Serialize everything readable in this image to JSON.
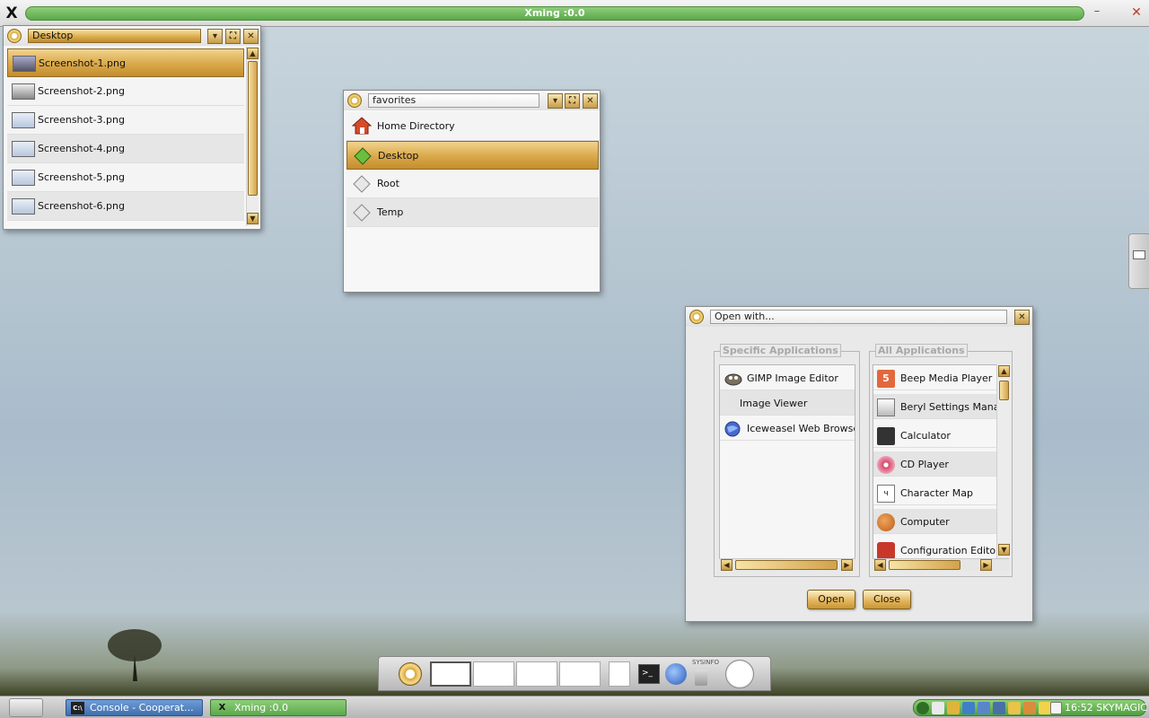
{
  "xming": {
    "title": "Xming :0.0",
    "logo": "X",
    "min": "–",
    "close": "✕"
  },
  "desktop_window": {
    "location": "Desktop",
    "files": [
      {
        "name": "Screenshot-1.png"
      },
      {
        "name": "Screenshot-2.png"
      },
      {
        "name": "Screenshot-3.png"
      },
      {
        "name": "Screenshot-4.png"
      },
      {
        "name": "Screenshot-5.png"
      },
      {
        "name": "Screenshot-6.png"
      }
    ]
  },
  "favorites_window": {
    "location": "favorites",
    "items": [
      {
        "name": "Home Directory",
        "icon": "home-icon"
      },
      {
        "name": "Desktop",
        "icon": "desktop-icon"
      },
      {
        "name": "Root",
        "icon": "root-icon"
      },
      {
        "name": "Temp",
        "icon": "temp-icon"
      }
    ]
  },
  "open_with": {
    "title": "Open with...",
    "specific_label": "Specific Applications",
    "all_label": "All Applications",
    "specific": [
      {
        "name": "GIMP Image Editor",
        "icon": "gimp-icon"
      },
      {
        "name": "Image Viewer",
        "icon": ""
      },
      {
        "name": "Iceweasel Web Browser",
        "icon": "globe-icon"
      }
    ],
    "all": [
      {
        "name": "Beep Media Player",
        "icon": "media-player-icon"
      },
      {
        "name": "Beryl Settings Manager",
        "icon": "settings-icon"
      },
      {
        "name": "Calculator",
        "icon": "calculator-icon"
      },
      {
        "name": "CD Player",
        "icon": "cd-icon"
      },
      {
        "name": "Character Map",
        "icon": "charmap-icon"
      },
      {
        "name": "Computer",
        "icon": "computer-icon"
      },
      {
        "name": "Configuration Editor",
        "icon": "config-icon"
      }
    ],
    "open_label": "Open",
    "close_label": "Close"
  },
  "dock": {
    "sysinfo_label": "SYSINFO"
  },
  "taskbar": {
    "tasks": [
      {
        "label": "Console - Cooperat...",
        "icon": "C:\\"
      },
      {
        "label": "Xming :0.0",
        "icon": "X"
      }
    ],
    "clock": "16:52 SKYMAGIC"
  },
  "colors": {
    "accent_gold": "#d9a849",
    "taskbar_green": "#5aa84a",
    "console_blue": "#4f7fb8"
  }
}
